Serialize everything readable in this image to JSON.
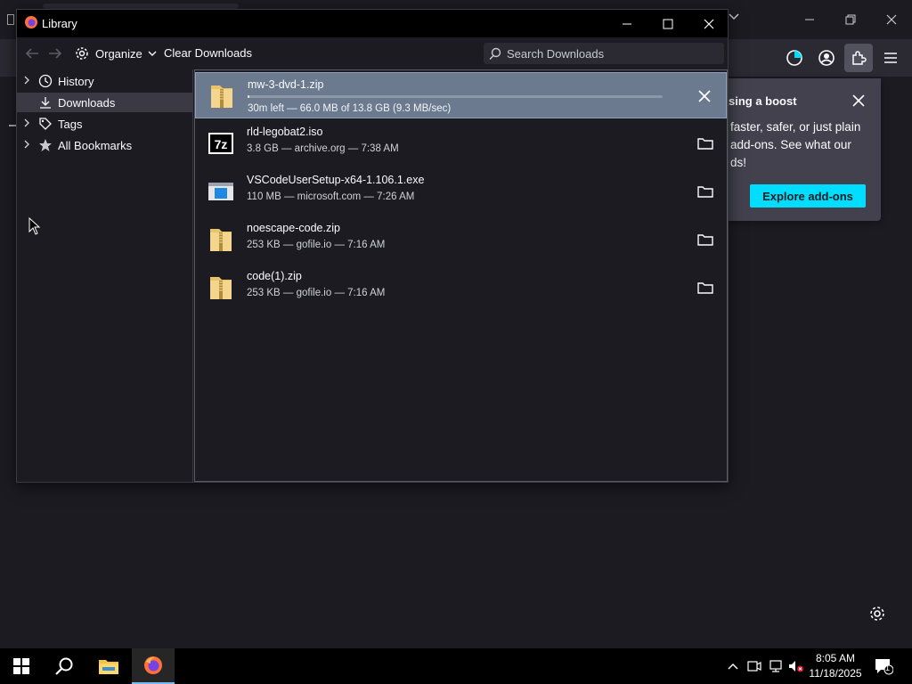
{
  "library_window": {
    "title": "Library",
    "toolbar": {
      "organize_label": "Organize",
      "clear_downloads_label": "Clear Downloads",
      "search_placeholder": "Search Downloads"
    },
    "sidebar": {
      "items": [
        {
          "label": "History",
          "icon": "history-icon",
          "expandable": true
        },
        {
          "label": "Downloads",
          "icon": "downloads-icon",
          "expandable": false,
          "selected": true
        },
        {
          "label": "Tags",
          "icon": "tag-icon",
          "expandable": true
        },
        {
          "label": "All Bookmarks",
          "icon": "star-icon",
          "expandable": true
        }
      ]
    },
    "downloads": [
      {
        "name": "mw-3-dvd-1.zip",
        "meta": "30m left — 66.0 MB of 13.8 GB (9.3 MB/sec)",
        "in_progress": true,
        "progress": 0.005,
        "action": "cancel",
        "file_icon": "zip-file-icon"
      },
      {
        "name": "rld-legobat2.iso",
        "meta": "3.8 GB — archive.org — 7:38 AM",
        "in_progress": false,
        "action": "show-in-folder",
        "file_icon": "7z-file-icon"
      },
      {
        "name": "VSCodeUserSetup-x64-1.106.1.exe",
        "meta": "110 MB — microsoft.com — 7:26 AM",
        "in_progress": false,
        "action": "show-in-folder",
        "file_icon": "exe-file-icon"
      },
      {
        "name": "noescape-code.zip",
        "meta": "253 KB — gofile.io — 7:16 AM",
        "in_progress": false,
        "action": "show-in-folder",
        "file_icon": "zip-file-icon"
      },
      {
        "name": "code(1).zip",
        "meta": "253 KB — gofile.io — 7:16 AM",
        "in_progress": false,
        "action": "show-in-folder",
        "file_icon": "zip-file-icon"
      }
    ]
  },
  "addon_popup": {
    "title": "sing a boost",
    "body": "faster, safer, or just plain add-ons. See what our ds!",
    "button_label": "Explore add-ons"
  },
  "taskbar": {
    "time": "8:05 AM",
    "date": "11/18/2025",
    "notification_count": "1"
  },
  "colors": {
    "accent_cyan": "#00ddff",
    "selected_row": "#6b7a8f",
    "window_bg": "#1c1b22"
  }
}
